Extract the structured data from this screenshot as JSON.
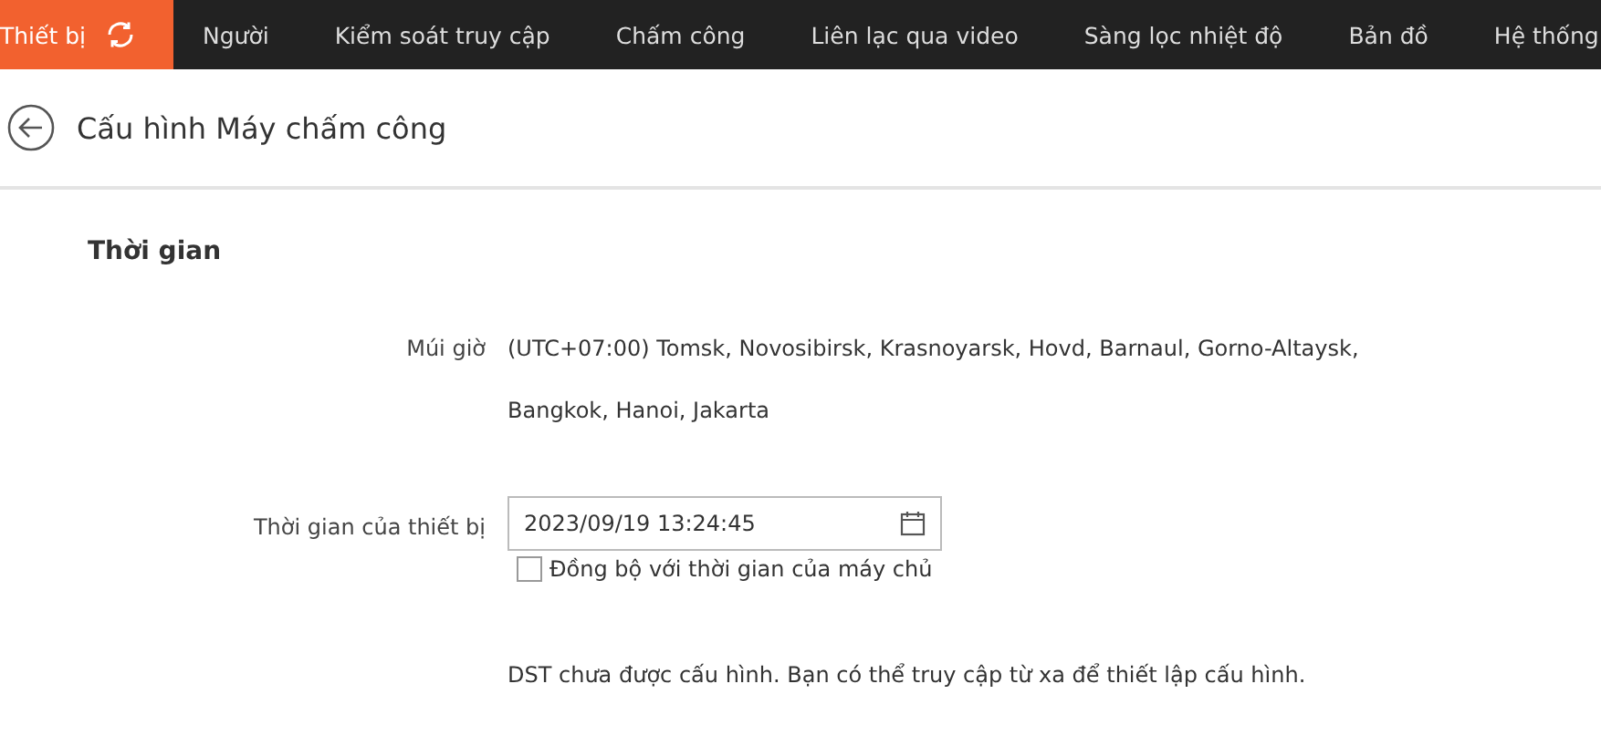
{
  "nav": [
    {
      "label": "Thiết bị",
      "selected": true
    },
    {
      "label": "Người",
      "selected": false
    },
    {
      "label": "Kiểm soát truy cập",
      "selected": false
    },
    {
      "label": "Chấm công",
      "selected": false
    },
    {
      "label": "Liên lạc qua video",
      "selected": false
    },
    {
      "label": "Sàng lọc nhiệt độ",
      "selected": false
    },
    {
      "label": "Bản đồ",
      "selected": false
    },
    {
      "label": "Hệ thống",
      "selected": false
    }
  ],
  "page_title": "Cấu hình Máy chấm công",
  "section_title": "Thời gian",
  "timezone": {
    "label": "Múi giờ",
    "value": "(UTC+07:00) Tomsk, Novosibirsk, Krasnoyarsk, Hovd, Barnaul, Gorno-Altaysk, Bangkok, Hanoi, Jakarta"
  },
  "device_time": {
    "label": "Thời gian của thiết bị",
    "value": "2023/09/19 13:24:45"
  },
  "sync": {
    "label": "Đồng bộ với thời gian của máy chủ",
    "checked": false
  },
  "dst_note": "DST chưa được cấu hình. Bạn có thể truy cập từ xa để thiết lập cấu hình."
}
